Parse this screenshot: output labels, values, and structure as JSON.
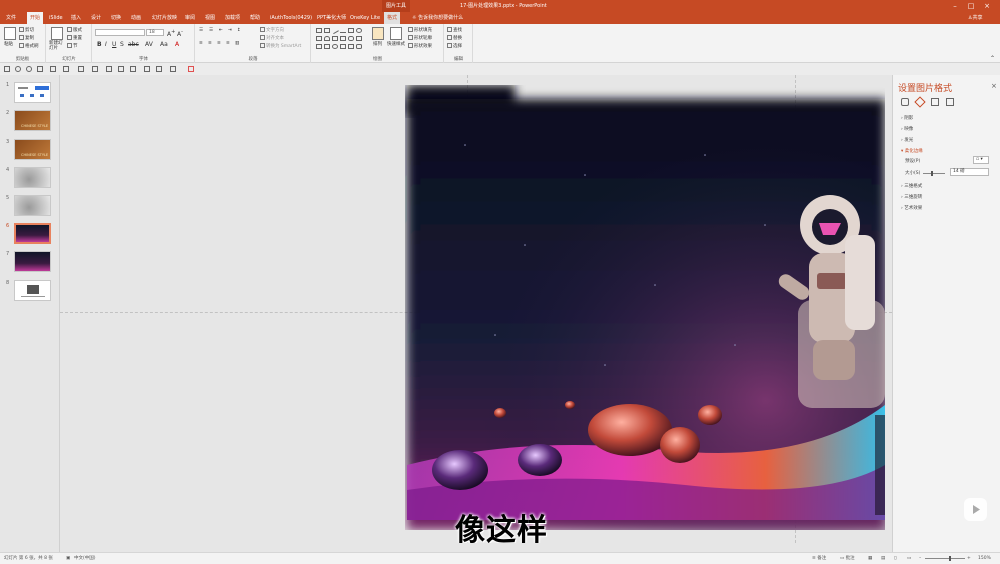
{
  "title_bar": {
    "context_tab": "图片工具",
    "document_title": "17-图片处理效果3.pptx - PowerPoint"
  },
  "tabs": [
    "文件",
    "开始",
    "iSlide",
    "插入",
    "设计",
    "切换",
    "动画",
    "幻灯片放映",
    "审阅",
    "视图",
    "加载项",
    "帮助",
    "iAuthTools(0429)",
    "PPT美化大师",
    "OneKey Lite",
    "格式"
  ],
  "active_tab": "开始",
  "tell_me": "告诉我你想要做什么",
  "share": "共享",
  "ribbon": {
    "clipboard": {
      "label": "剪贴板",
      "paste": "粘贴",
      "cut": "剪切",
      "copy": "复制",
      "format_painter": "格式刷"
    },
    "slides": {
      "label": "幻灯片",
      "new_slide": "新建幻灯片",
      "layout": "版式",
      "reset": "重置",
      "section": "节"
    },
    "font": {
      "label": "字体",
      "font_name": "",
      "font_size": "18"
    },
    "paragraph": {
      "label": "段落",
      "text_direction": "文字方向",
      "align_text": "对齐文本",
      "smartart": "转换为 SmartArt"
    },
    "drawing": {
      "label": "绘图",
      "arrange": "排列",
      "quick_styles": "快速样式",
      "shape_fill": "形状填充",
      "shape_outline": "形状轮廓",
      "shape_effects": "形状效果"
    },
    "editing": {
      "label": "编辑",
      "find": "查找",
      "replace": "替换",
      "select": "选择"
    }
  },
  "slides": [
    {
      "num": "1"
    },
    {
      "num": "2"
    },
    {
      "num": "3"
    },
    {
      "num": "4"
    },
    {
      "num": "5"
    },
    {
      "num": "6"
    },
    {
      "num": "7"
    },
    {
      "num": "8"
    }
  ],
  "selected_slide": "6",
  "thumb_texts": {
    "chinese_style": "CHINESE STYLE"
  },
  "subtitle": "像这样",
  "format_pane": {
    "title": "设置图片格式",
    "close": "×",
    "sections": [
      "阴影",
      "映像",
      "发光",
      "柔化边缘",
      "三维格式",
      "三维旋转",
      "艺术效果"
    ],
    "open_section": "柔化边缘",
    "preset_label": "预设(P)",
    "size_label": "大小(S)",
    "size_value": "14 磅"
  },
  "status": {
    "slide_info": "幻灯片 第 6 张，共 8 张",
    "language": "中文(中国)",
    "notes": "备注",
    "comments": "批注",
    "zoom": "150%"
  },
  "colors": {
    "accent": "#c64a24"
  }
}
